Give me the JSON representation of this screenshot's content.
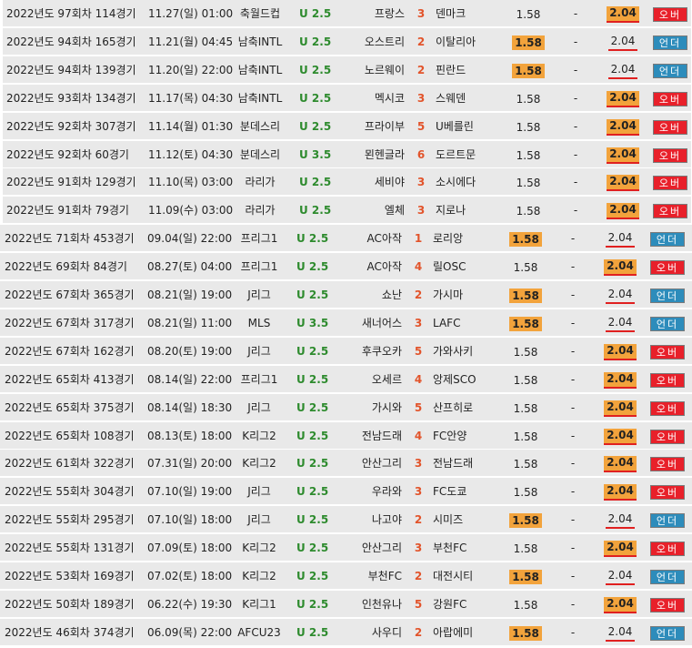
{
  "colors": {
    "row_bg": "#e9e9e9",
    "ou_green": "#2e8b2e",
    "score_orange": "#e2542b",
    "odds_highlight": "#f2a33c",
    "underline_red": "#e02020",
    "badge_over": "#e8202a",
    "badge_under": "#2d8cbb"
  },
  "dash": "-",
  "rows": [
    {
      "round": "2022년도 97회차 114경기",
      "date": "11.27(일) 01:00",
      "league": "축월드컵",
      "ou": "U 2.5",
      "home": "프랑스",
      "score": "3",
      "away": "덴마크",
      "o1": "1.58",
      "o2": "2.04",
      "result": "오버",
      "res": "over",
      "win": 2
    },
    {
      "round": "2022년도 94회차 165경기",
      "date": "11.21(월) 04:45",
      "league": "남축INTL",
      "ou": "U 2.5",
      "home": "오스트리",
      "score": "2",
      "away": "이탈리아",
      "o1": "1.58",
      "o2": "2.04",
      "result": "언더",
      "res": "under",
      "win": 1
    },
    {
      "round": "2022년도 94회차 139경기",
      "date": "11.20(일) 22:00",
      "league": "남축INTL",
      "ou": "U 2.5",
      "home": "노르웨이",
      "score": "2",
      "away": "핀란드",
      "o1": "1.58",
      "o2": "2.04",
      "result": "언더",
      "res": "under",
      "win": 1
    },
    {
      "round": "2022년도 93회차 134경기",
      "date": "11.17(목) 04:30",
      "league": "남축INTL",
      "ou": "U 2.5",
      "home": "멕시코",
      "score": "3",
      "away": "스웨덴",
      "o1": "1.58",
      "o2": "2.04",
      "result": "오버",
      "res": "over",
      "win": 2
    },
    {
      "round": "2022년도 92회차 307경기",
      "date": "11.14(월) 01:30",
      "league": "분데스리",
      "ou": "U 2.5",
      "home": "프라이부",
      "score": "5",
      "away": "U베를린",
      "o1": "1.58",
      "o2": "2.04",
      "result": "오버",
      "res": "over",
      "win": 2
    },
    {
      "round": "2022년도 92회차 60경기",
      "date": "11.12(토) 04:30",
      "league": "분데스리",
      "ou": "U 3.5",
      "home": "묀헨글라",
      "score": "6",
      "away": "도르트문",
      "o1": "1.58",
      "o2": "2.04",
      "result": "오버",
      "res": "over",
      "win": 2
    },
    {
      "round": "2022년도 91회차 129경기",
      "date": "11.10(목) 03:00",
      "league": "라리가",
      "ou": "U 2.5",
      "home": "세비야",
      "score": "3",
      "away": "소시에다",
      "o1": "1.58",
      "o2": "2.04",
      "result": "오버",
      "res": "over",
      "win": 2
    },
    {
      "round": "2022년도 91회차 79경기",
      "date": "11.09(수) 03:00",
      "league": "라리가",
      "ou": "U 2.5",
      "home": "엘체",
      "score": "3",
      "away": "지로나",
      "o1": "1.58",
      "o2": "2.04",
      "result": "오버",
      "res": "over",
      "win": 2
    },
    {
      "round": "2022년도 71회차 453경기",
      "date": "09.04(일) 22:00",
      "league": "프리그1",
      "ou": "U 2.5",
      "home": "AC아작",
      "score": "1",
      "away": "로리앙",
      "o1": "1.58",
      "o2": "2.04",
      "result": "언더",
      "res": "under",
      "win": 1
    },
    {
      "round": "2022년도 69회차 84경기",
      "date": "08.27(토) 04:00",
      "league": "프리그1",
      "ou": "U 2.5",
      "home": "AC아작",
      "score": "4",
      "away": "릴OSC",
      "o1": "1.58",
      "o2": "2.04",
      "result": "오버",
      "res": "over",
      "win": 2
    },
    {
      "round": "2022년도 67회차 365경기",
      "date": "08.21(일) 19:00",
      "league": "J리그",
      "ou": "U 2.5",
      "home": "쇼난",
      "score": "2",
      "away": "가시마",
      "o1": "1.58",
      "o2": "2.04",
      "result": "언더",
      "res": "under",
      "win": 1
    },
    {
      "round": "2022년도 67회차 317경기",
      "date": "08.21(일) 11:00",
      "league": "MLS",
      "ou": "U 3.5",
      "home": "새너어스",
      "score": "3",
      "away": "LAFC",
      "o1": "1.58",
      "o2": "2.04",
      "result": "언더",
      "res": "under",
      "win": 1
    },
    {
      "round": "2022년도 67회차 162경기",
      "date": "08.20(토) 19:00",
      "league": "J리그",
      "ou": "U 2.5",
      "home": "후쿠오카",
      "score": "5",
      "away": "가와사키",
      "o1": "1.58",
      "o2": "2.04",
      "result": "오버",
      "res": "over",
      "win": 2
    },
    {
      "round": "2022년도 65회차 413경기",
      "date": "08.14(일) 22:00",
      "league": "프리그1",
      "ou": "U 2.5",
      "home": "오세르",
      "score": "4",
      "away": "앙제SCO",
      "o1": "1.58",
      "o2": "2.04",
      "result": "오버",
      "res": "over",
      "win": 2
    },
    {
      "round": "2022년도 65회차 375경기",
      "date": "08.14(일) 18:30",
      "league": "J리그",
      "ou": "U 2.5",
      "home": "가시와",
      "score": "5",
      "away": "산프히로",
      "o1": "1.58",
      "o2": "2.04",
      "result": "오버",
      "res": "over",
      "win": 2
    },
    {
      "round": "2022년도 65회차 108경기",
      "date": "08.13(토) 18:00",
      "league": "K리그2",
      "ou": "U 2.5",
      "home": "전남드래",
      "score": "4",
      "away": "FC안양",
      "o1": "1.58",
      "o2": "2.04",
      "result": "오버",
      "res": "over",
      "win": 2
    },
    {
      "round": "2022년도 61회차 322경기",
      "date": "07.31(일) 20:00",
      "league": "K리그2",
      "ou": "U 2.5",
      "home": "안산그리",
      "score": "3",
      "away": "전남드래",
      "o1": "1.58",
      "o2": "2.04",
      "result": "오버",
      "res": "over",
      "win": 2
    },
    {
      "round": "2022년도 55회차 304경기",
      "date": "07.10(일) 19:00",
      "league": "J리그",
      "ou": "U 2.5",
      "home": "우라와",
      "score": "3",
      "away": "FC도쿄",
      "o1": "1.58",
      "o2": "2.04",
      "result": "오버",
      "res": "over",
      "win": 2
    },
    {
      "round": "2022년도 55회차 295경기",
      "date": "07.10(일) 18:00",
      "league": "J리그",
      "ou": "U 2.5",
      "home": "나고야",
      "score": "2",
      "away": "시미즈",
      "o1": "1.58",
      "o2": "2.04",
      "result": "언더",
      "res": "under",
      "win": 1
    },
    {
      "round": "2022년도 55회차 131경기",
      "date": "07.09(토) 18:00",
      "league": "K리그2",
      "ou": "U 2.5",
      "home": "안산그리",
      "score": "3",
      "away": "부천FC",
      "o1": "1.58",
      "o2": "2.04",
      "result": "오버",
      "res": "over",
      "win": 2
    },
    {
      "round": "2022년도 53회차 169경기",
      "date": "07.02(토) 18:00",
      "league": "K리그2",
      "ou": "U 2.5",
      "home": "부천FC",
      "score": "2",
      "away": "대전시티",
      "o1": "1.58",
      "o2": "2.04",
      "result": "언더",
      "res": "under",
      "win": 1
    },
    {
      "round": "2022년도 50회차 189경기",
      "date": "06.22(수) 19:30",
      "league": "K리그1",
      "ou": "U 2.5",
      "home": "인천유나",
      "score": "5",
      "away": "강원FC",
      "o1": "1.58",
      "o2": "2.04",
      "result": "오버",
      "res": "over",
      "win": 2
    },
    {
      "round": "2022년도 46회차 374경기",
      "date": "06.09(목) 22:00",
      "league": "AFCU23",
      "ou": "U 2.5",
      "home": "사우디",
      "score": "2",
      "away": "아랍에미",
      "o1": "1.58",
      "o2": "2.04",
      "result": "언더",
      "res": "under",
      "win": 1
    }
  ]
}
